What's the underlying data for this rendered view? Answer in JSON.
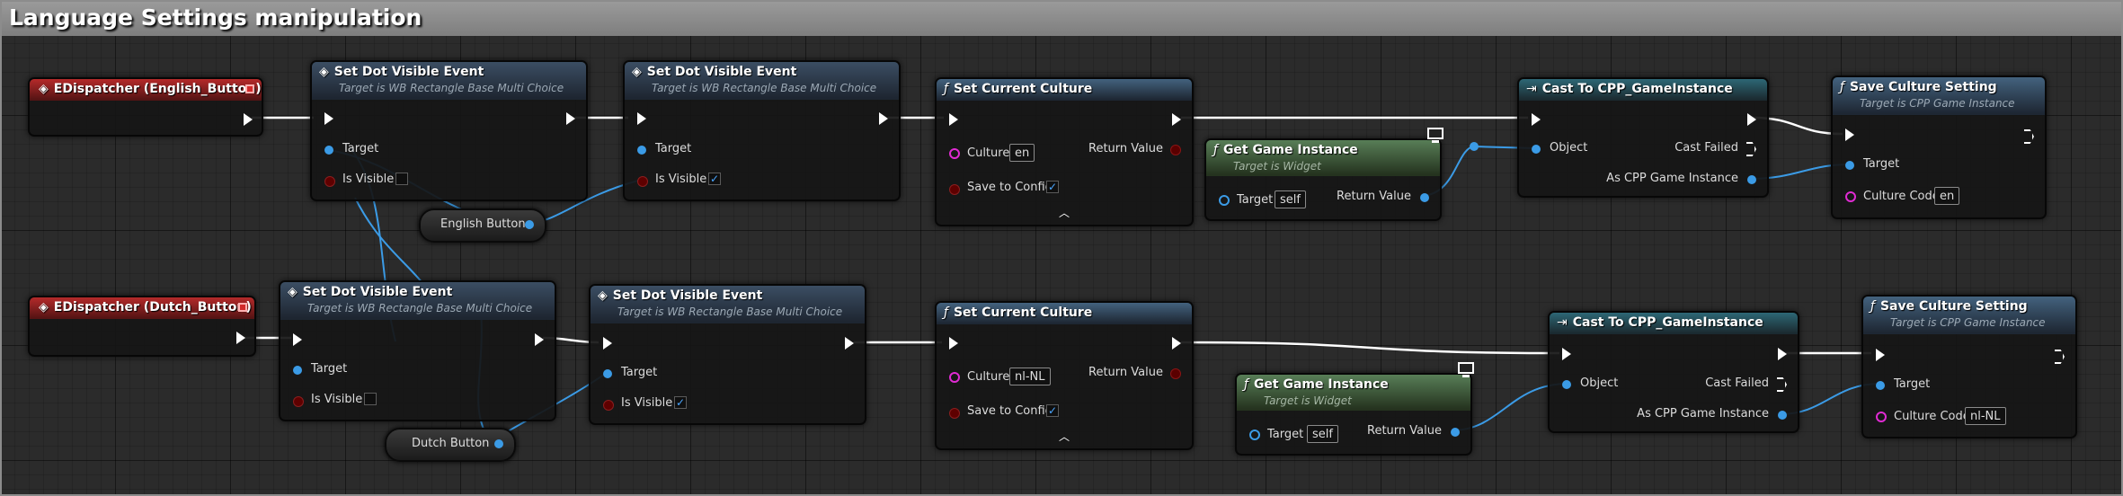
{
  "comment": {
    "title": "Language Settings manipulation"
  },
  "rows": [
    {
      "dispatcher": "EDispatcher (English_Button)",
      "set_dot_a": {
        "title": "Set Dot Visible Event",
        "subtitle": "Target is WB Rectangle Base Multi Choice",
        "target_label": "Target",
        "visible_label": "Is Visible",
        "visible_checked": false
      },
      "set_dot_b": {
        "title": "Set Dot Visible Event",
        "subtitle": "Target is WB Rectangle Base Multi Choice",
        "target_label": "Target",
        "visible_label": "Is Visible",
        "visible_checked": true
      },
      "button_var": "English Button",
      "set_culture": {
        "title": "Set Current Culture",
        "culture_label": "Culture",
        "culture_value": "en",
        "return_label": "Return Value",
        "save_label": "Save to Config",
        "save_checked": true
      },
      "get_gi": {
        "title": "Get Game Instance",
        "subtitle": "Target is Widget",
        "target_label": "Target",
        "target_value": "self",
        "return_label": "Return Value"
      },
      "cast": {
        "title": "Cast To CPP_GameInstance",
        "object_label": "Object",
        "failed_label": "Cast Failed",
        "as_label": "As CPP Game Instance"
      },
      "save": {
        "title": "Save Culture Setting",
        "subtitle": "Target is CPP Game Instance",
        "target_label": "Target",
        "code_label": "Culture Code",
        "code_value": "en"
      }
    },
    {
      "dispatcher": "EDispatcher (Dutch_Button)",
      "set_dot_a": {
        "title": "Set Dot Visible Event",
        "subtitle": "Target is WB Rectangle Base Multi Choice",
        "target_label": "Target",
        "visible_label": "Is Visible",
        "visible_checked": false
      },
      "set_dot_b": {
        "title": "Set Dot Visible Event",
        "subtitle": "Target is WB Rectangle Base Multi Choice",
        "target_label": "Target",
        "visible_label": "Is Visible",
        "visible_checked": true
      },
      "button_var": "Dutch Button",
      "set_culture": {
        "title": "Set Current Culture",
        "culture_label": "Culture",
        "culture_value": "nl-NL",
        "return_label": "Return Value",
        "save_label": "Save to Config",
        "save_checked": true
      },
      "get_gi": {
        "title": "Get Game Instance",
        "subtitle": "Target is Widget",
        "target_label": "Target",
        "target_value": "self",
        "return_label": "Return Value"
      },
      "cast": {
        "title": "Cast To CPP_GameInstance",
        "object_label": "Object",
        "failed_label": "Cast Failed",
        "as_label": "As CPP Game Instance"
      },
      "save": {
        "title": "Save Culture Setting",
        "subtitle": "Target is CPP Game Instance",
        "target_label": "Target",
        "code_label": "Culture Code",
        "code_value": "nl-NL"
      }
    }
  ],
  "icons": {
    "event": "diamond-event-icon",
    "function": "function-f-icon",
    "cast": "cast-arrow-icon",
    "pin_visual": "monitor-icon",
    "advanced": "chevron-up-icon"
  },
  "colors": {
    "exec_wire": "#ffffff",
    "object_wire": "#3b9be6",
    "string_pin": "#e02bd3",
    "bool_pin": "#8a1f1f",
    "dispatcher_header": "#b52a2a",
    "pure_header": "#587e57"
  }
}
